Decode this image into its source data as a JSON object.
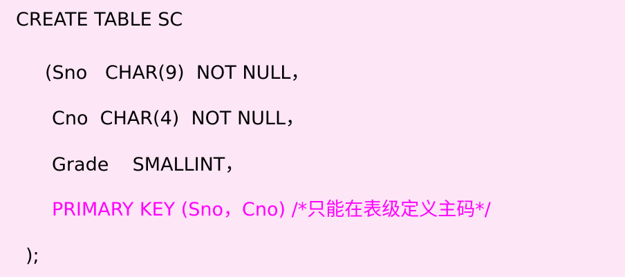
{
  "code": {
    "lines": [
      {
        "text": "CREATE TABLE SC"
      },
      {
        "text": "(Sno   CHAR(9)  NOT NULL，"
      },
      {
        "text": "Cno  CHAR(4)  NOT NULL，"
      },
      {
        "text": "Grade    SMALLINT，"
      },
      {
        "text": "PRIMARY KEY (Sno，Cno) /*只能在表级定义主码*/"
      },
      {
        "text": ");"
      }
    ],
    "colors": {
      "text": "#000000",
      "highlight": "#ff00ff",
      "background": "#fde6f6"
    }
  }
}
